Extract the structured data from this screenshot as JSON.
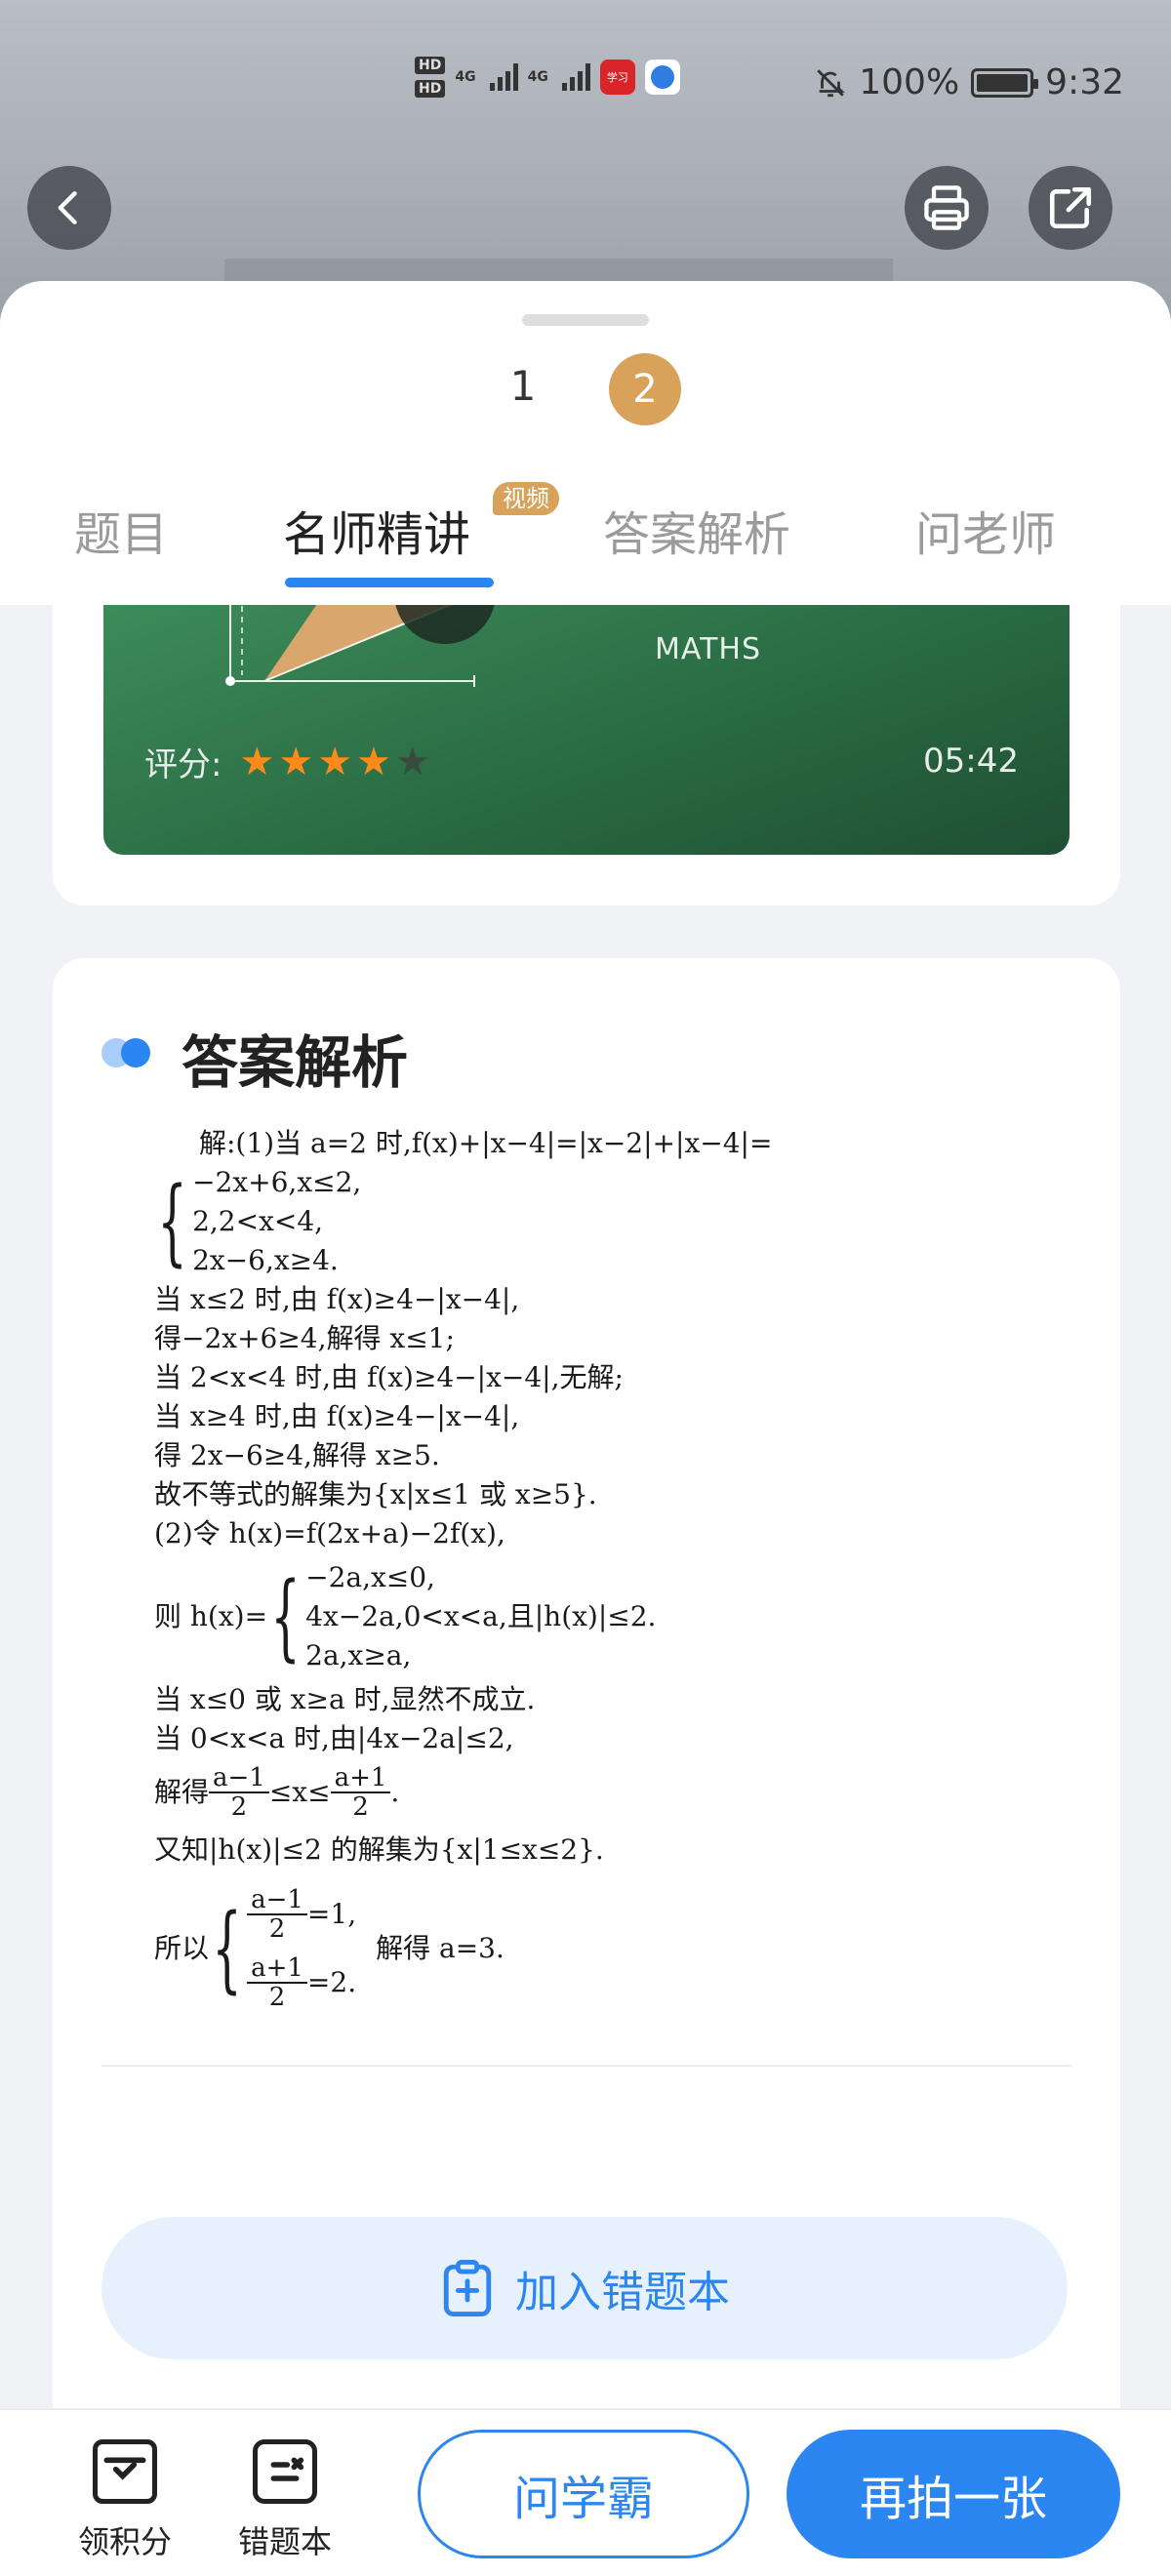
{
  "status_bar": {
    "hd1": "HD",
    "hd2": "HD",
    "net1": "4G",
    "net2": "4G",
    "app1_label": "学习",
    "battery": "100%",
    "time": "9:32"
  },
  "header": {
    "back_icon": "chevron-left-icon",
    "print_icon": "printer-icon",
    "share_icon": "share-icon"
  },
  "pager": {
    "page1": "1",
    "page2": "2",
    "current": 2
  },
  "tabs": [
    {
      "label": "题目"
    },
    {
      "label": "名师精讲",
      "badge": "视频",
      "active": true
    },
    {
      "label": "答案解析"
    },
    {
      "label": "问老师"
    }
  ],
  "video": {
    "watermark": "MATHS",
    "rating_label": "评分:",
    "rating_value": 4,
    "rating_max": 5,
    "duration": "05:42",
    "colors": {
      "star_on": "#ff8a1c",
      "star_off": "#3a4a3f"
    }
  },
  "answer_section": {
    "title": "答案解析",
    "solution_lines": [
      "解:(1)当 a=2 时,f(x)+|x−4|=|x−2|+|x−4|=",
      "−2x+6,x≤2,",
      "2,2<x<4,",
      "2x−6,x≥4.",
      "当 x≤2 时,由 f(x)≥4−|x−4|,",
      "得−2x+6≥4,解得 x≤1;",
      "当 2<x<4 时,由 f(x)≥4−|x−4|,无解;",
      "当 x≥4 时,由 f(x)≥4−|x−4|,",
      "得 2x−6≥4,解得 x≥5.",
      "故不等式的解集为{x|x≤1 或 x≥5}.",
      "(2)令 h(x)=f(2x+a)−2f(x),",
      "−2a,x≤0,",
      "则 h(x)=",
      "4x−2a,0<x<a,且|h(x)|≤2.",
      "2a,x≥a,",
      "当 x≤0 或 x≥a 时,显然不成立.",
      "当 0<x<a 时,由|4x−2a|≤2,",
      "解得",
      "a−1",
      "2",
      "≤x≤",
      "a+1",
      "2",
      ".",
      "又知|h(x)|≤2 的解集为{x|1≤x≤2}.",
      "所以",
      "a−1",
      "2",
      "=1,",
      "解得 a=3.",
      "a+1",
      "2",
      "=2."
    ],
    "add_button_label": "加入错题本",
    "add_icon": "clipboard-plus-icon"
  },
  "bottom_bar": {
    "points_label": "领积分",
    "points_icon": "calendar-check-icon",
    "wrongbook_label": "错题本",
    "wrongbook_icon": "wrong-book-icon",
    "ask_button": "问学霸",
    "retake_button": "再拍一张"
  },
  "colors": {
    "accent": "#2c86f2",
    "gold": "#d8a25a",
    "video_green": "#2e7249"
  }
}
